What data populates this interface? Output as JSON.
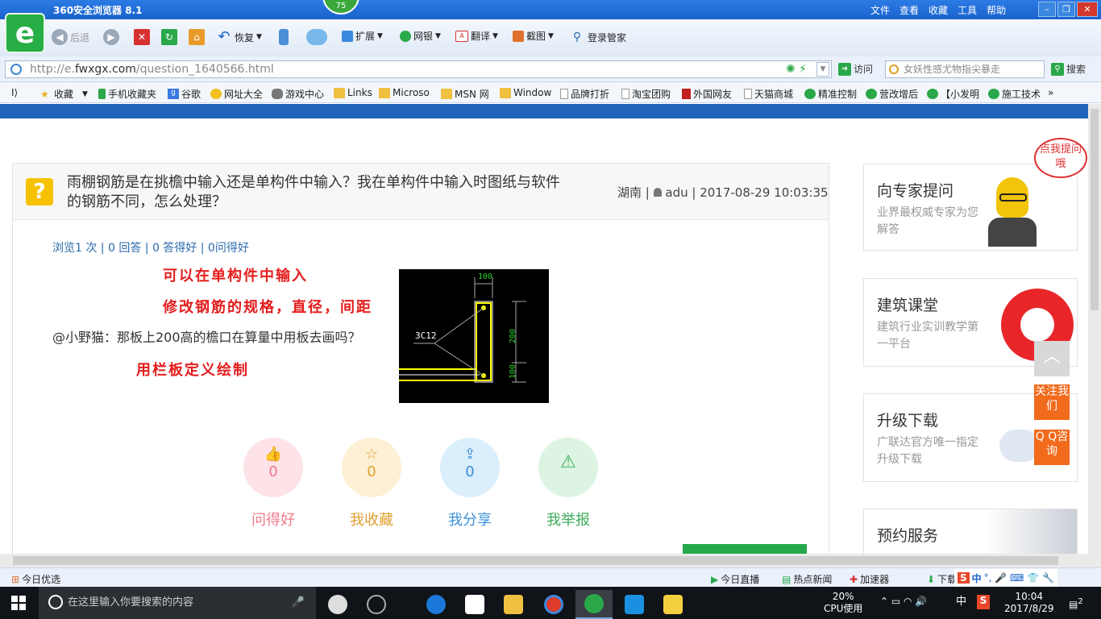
{
  "browser": {
    "title": "360安全浏览器 8.1",
    "badge": "75",
    "menu": [
      "文件",
      "查看",
      "收藏",
      "工具",
      "帮助"
    ],
    "toolbar": {
      "back": "后退",
      "restore": "恢复",
      "extend": "扩展",
      "netbank": "网银",
      "translate": "翻译",
      "screenshot": "截图",
      "login_manager": "登录管家"
    },
    "url_prefix": "http://e.",
    "url_domain": "fwxgx.com",
    "url_path": "/question_1640566.html",
    "visit": "访问",
    "search_placeholder": "女妖性感尤物指尖暴走",
    "search_label": "搜索",
    "favorites": [
      "收藏",
      "手机收藏夹",
      "谷歌",
      "网址大全",
      "游戏中心",
      "Links",
      "Microso",
      "MSN 网",
      "Window",
      "品牌打折",
      "淘宝团购",
      "外国网友",
      "天猫商城",
      "精准控制",
      "营改增后",
      "【小发明",
      "施工技术"
    ]
  },
  "question": {
    "title": "雨棚钢筋是在挑檐中输入还是单构件中输入？我在单构件中输入时图纸与软件的钢筋不同，怎么处理？",
    "region": "湖南",
    "user": "adu",
    "datetime": "2017-08-29 10:03:35",
    "stats": "浏览1 次 | 0 回答 | 0 答得好 | 0问得好",
    "annotation1": "可以在单构件中输入",
    "annotation2": "修改钢筋的规格，直径，间距",
    "comment": "@小野猫：那板上200高的檐口在算量中用板去画吗？",
    "annotation3": "用栏板定义绘制",
    "cad": {
      "dim_top": "100",
      "dim_side": "200",
      "dim_bottom": "100",
      "label": "3C12"
    }
  },
  "actions": [
    {
      "label": "问得好",
      "count": "0",
      "color": "#f07a8a",
      "bg": "#fde3e8",
      "icon": "👍"
    },
    {
      "label": "我收藏",
      "count": "0",
      "color": "#e0a030",
      "bg": "#fdf0d4",
      "icon": "☆"
    },
    {
      "label": "我分享",
      "count": "0",
      "color": "#3a90d8",
      "bg": "#dbeefc",
      "icon": "⇪"
    },
    {
      "label": "我举报",
      "count": "",
      "color": "#3cab5a",
      "bg": "#ddf4e2",
      "icon": "⚠"
    }
  ],
  "sidebar": {
    "ask_title": "向专家提问",
    "ask_desc": "业界最权威专家为您解答",
    "course_title": "建筑课堂",
    "course_desc": "建筑行业实训教学第一平台",
    "download_title": "升级下载",
    "download_desc": "广联达官方唯一指定升级下载",
    "booking_title": "预约服务",
    "speech": "点我提问哦",
    "follow": "关注我们",
    "qq": "Q Q咨询"
  },
  "statusbar": {
    "today": "今日优选",
    "live": "今日直播",
    "hotnews": "热点新闻",
    "accelerator": "加速器",
    "download": "下载"
  },
  "taskbar": {
    "search_placeholder": "在这里输入你要搜索的内容",
    "cpu_percent": "20%",
    "cpu_label": "CPU使用",
    "ime": "中",
    "time": "10:04",
    "date": "2017/8/29",
    "notifications": "2"
  }
}
